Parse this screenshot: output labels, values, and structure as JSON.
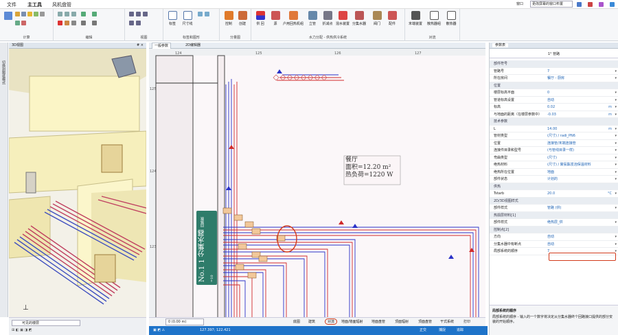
{
  "menubar": {
    "items": [
      "文件",
      "主工具",
      "风机盘管"
    ],
    "right_window": "窗口",
    "right_dropdown": "更改屏幕的窗口布置"
  },
  "ribbon": {
    "groups": [
      "计算",
      "编辑",
      "视图",
      "标签和图形",
      "分量图",
      "水力分配 - 供热供冷系统",
      "对流"
    ],
    "buttons": [
      "标签",
      "尺寸线",
      "控制",
      "创建",
      "供 回",
      "源",
      "户用回热机组",
      "立管",
      "折减点",
      "混水装置",
      "分集水器",
      "阀门",
      "配件",
      "末端装置",
      "散热器组",
      "散热器"
    ]
  },
  "left_strip": {
    "label": "切换到图纸模式"
  },
  "view3d": {
    "title": "3D视图",
    "pin": "# ×"
  },
  "view2d": {
    "tabs": [
      "一般参数",
      "2D编辑器"
    ],
    "ruler_x": [
      "124",
      "125",
      "126",
      "127"
    ],
    "ruler_y": [
      "125",
      "124",
      "123"
    ],
    "room": {
      "name": "餐厅",
      "area": "面积=12.20 m²",
      "load": "热负荷=1220 W"
    },
    "manifold": {
      "label": "No.1 1 分集水器",
      "sub": "回路数=10"
    }
  },
  "props": {
    "tab": "参数表",
    "title": "1° 管路",
    "rows": [
      {
        "type": "cat",
        "label": "部件符号"
      },
      {
        "label": "管路号",
        "value": "7"
      },
      {
        "label": "所在房间",
        "value": "餐厅 - 厨房"
      },
      {
        "type": "cat",
        "label": "位置"
      },
      {
        "label": "楼层标高平面",
        "value": "0"
      },
      {
        "label": "管道标高设置",
        "value": "自动"
      },
      {
        "label": "标高",
        "value": "0.02",
        "unit": "m"
      },
      {
        "label": "与地面的距离（在楼层参数中）",
        "value": "-0.03",
        "unit": "m"
      },
      {
        "type": "cat",
        "label": "技术参数"
      },
      {
        "label": "L",
        "value": "14.00",
        "unit": "m"
      },
      {
        "label": "管材类型",
        "value": "(尺寸) / radi_PN6"
      },
      {
        "label": "位置",
        "value": "连接管/末端连接管"
      },
      {
        "label": "连接件目录和型号",
        "value": "(与管线目录一样)"
      },
      {
        "label": "弯曲类型",
        "value": "(尺寸)"
      },
      {
        "label": "绝热材料",
        "value": "(尺寸) / 聚氨酯发泡保温材料"
      },
      {
        "label": "绝热所在位置",
        "value": "地面"
      },
      {
        "label": "部件状态",
        "value": "计划的"
      },
      {
        "type": "cat",
        "label": "供热"
      },
      {
        "label": "Tstarb",
        "value": "20.0",
        "unit": "°C"
      },
      {
        "type": "cat",
        "label": "2D/3D视图样式"
      },
      {
        "label": "部件样式",
        "value": "管路 (供)"
      },
      {
        "type": "cat",
        "label": "热损层材料[1]"
      },
      {
        "label": "部件样式",
        "value": "绝热层_供"
      },
      {
        "type": "cat",
        "label": "控制点[2]"
      },
      {
        "label": "方向",
        "value": "自动"
      },
      {
        "label": "分集水器中有断点",
        "value": "自动"
      },
      {
        "label": "局部系统的顺序",
        "value": "7"
      }
    ],
    "help_title": "局部系统的顺序",
    "help_text": "局部系统的顺序 - 输入的一个数字将决定从分集水器终个回路接口提供的部分安装的开始顺序。"
  },
  "status_left": {
    "dropdown": "可见的楼层",
    "level": "0 (0.00 m)"
  },
  "bottom_tabs": [
    "底图",
    "建筑",
    "对流",
    "地面/墙面辐射",
    "地面盘管",
    "顶面辐射",
    "顶面盘管",
    "干式系统",
    "打印"
  ],
  "bluebar": {
    "coords": "127.397; 122.421",
    "right": [
      "正交",
      "捕捉",
      "追踪"
    ]
  }
}
